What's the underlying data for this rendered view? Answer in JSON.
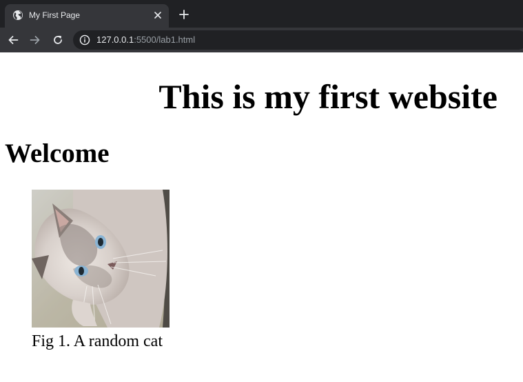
{
  "browser": {
    "tab": {
      "title": "My First Page",
      "favicon": "globe-icon"
    },
    "address_bar": {
      "host": "127.0.0.1",
      "rest": ":5500/lab1.html"
    },
    "icons": {
      "close": "close-icon",
      "new_tab": "plus-icon",
      "back": "arrow-left-icon",
      "forward": "arrow-right-icon",
      "reload": "reload-icon",
      "site_info": "info-icon"
    },
    "colors": {
      "frame": "#202124",
      "toolbar": "#35363a",
      "text": "#e8eaed",
      "muted": "#9aa0a6"
    }
  },
  "page": {
    "title": "This is my first website",
    "heading": "Welcome",
    "figure": {
      "image": "cat-photo",
      "caption": "Fig 1. A random cat"
    }
  }
}
